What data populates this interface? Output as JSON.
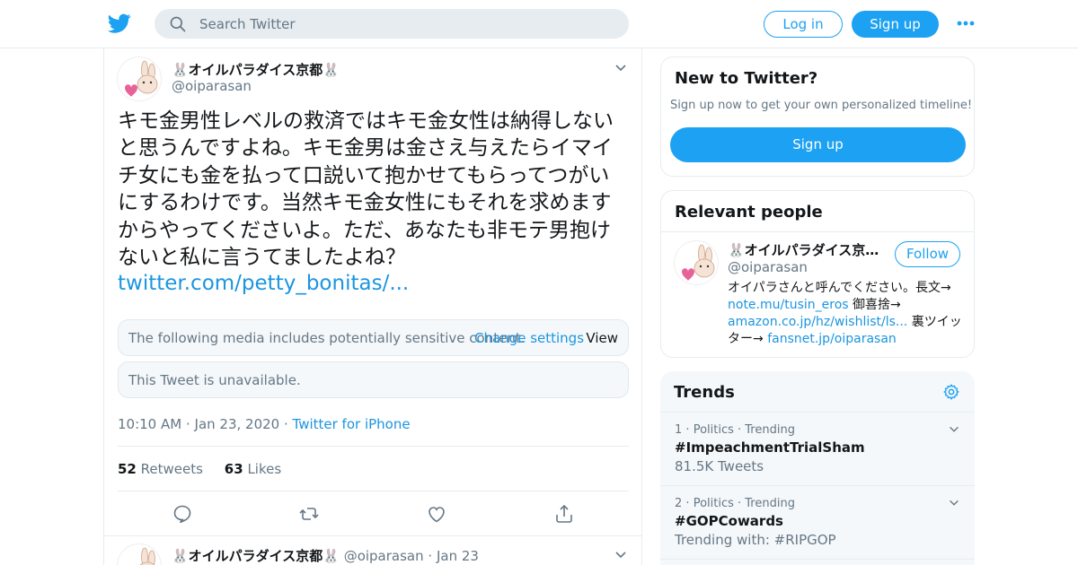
{
  "header": {
    "search_placeholder": "Search Twitter",
    "login_label": "Log in",
    "signup_label": "Sign up"
  },
  "tweet": {
    "display_name": "🐰オイルパラダイス京都🐰",
    "handle": "@oiparasan",
    "text": "キモ金男性レベルの救済ではキモ金女性は納得しないと思うんですよね。キモ金男は金さえ与えたらイマイチ女にも金を払って口説いて抱かせてもらってつがいにするわけです。当然キモ金女性にもそれを求めますからやってくださいよ。ただ、あなたも非モテ男抱けないと私に言うてましたよね？",
    "link": "twitter.com/petty_bonitas/...",
    "media_notice": "The following media includes potentially sensitive content.",
    "media_change_settings": "Change settings",
    "media_view": "View",
    "unavailable": "This Tweet is unavailable.",
    "time": "10:10 AM",
    "date": "Jan 23, 2020",
    "source": "Twitter for iPhone",
    "retweets_count": "52",
    "retweets_label": "Retweets",
    "likes_count": "63",
    "likes_label": "Likes"
  },
  "next_tweet": {
    "display_name": "🐰オイルパラダイス京都🐰",
    "handle": "@oiparasan",
    "date": "Jan 23"
  },
  "sidebar": {
    "new_title": "New to Twitter?",
    "new_sub": "Sign up now to get your own personalized timeline!",
    "new_signup": "Sign up",
    "people_title": "Relevant people",
    "person": {
      "name": "🐰オイルパラダイス京都🐰",
      "handle": "@oiparasan",
      "follow": "Follow",
      "bio_1": "オイパラさんと呼んでください。長文→ ",
      "bio_link_1": "note.mu/tusin_eros",
      "bio_2": " 御喜捨→ ",
      "bio_link_2": "amazon.co.jp/hz/wishlist/ls...",
      "bio_3": " 裏ツイッター→ ",
      "bio_link_3": "fansnet.jp/oiparasan"
    },
    "trends_title": "Trends",
    "trends": [
      {
        "rank": "1",
        "category": "Politics",
        "status": "Trending",
        "topic": "#ImpeachmentTrialSham",
        "count": "81.5K Tweets"
      },
      {
        "rank": "2",
        "category": "Politics",
        "status": "Trending",
        "topic": "#GOPCowards",
        "count": "Trending with: #RIPGOP"
      }
    ]
  },
  "colors": {
    "accent": "#1da1f2",
    "link": "#1b95e0",
    "muted": "#657786",
    "border": "#e6ecf0"
  },
  "icons": [
    "twitter-bird-icon",
    "search-icon",
    "more-dots-icon",
    "chevron-down-icon",
    "reply-icon",
    "retweet-icon",
    "like-icon",
    "share-icon",
    "gear-icon"
  ]
}
